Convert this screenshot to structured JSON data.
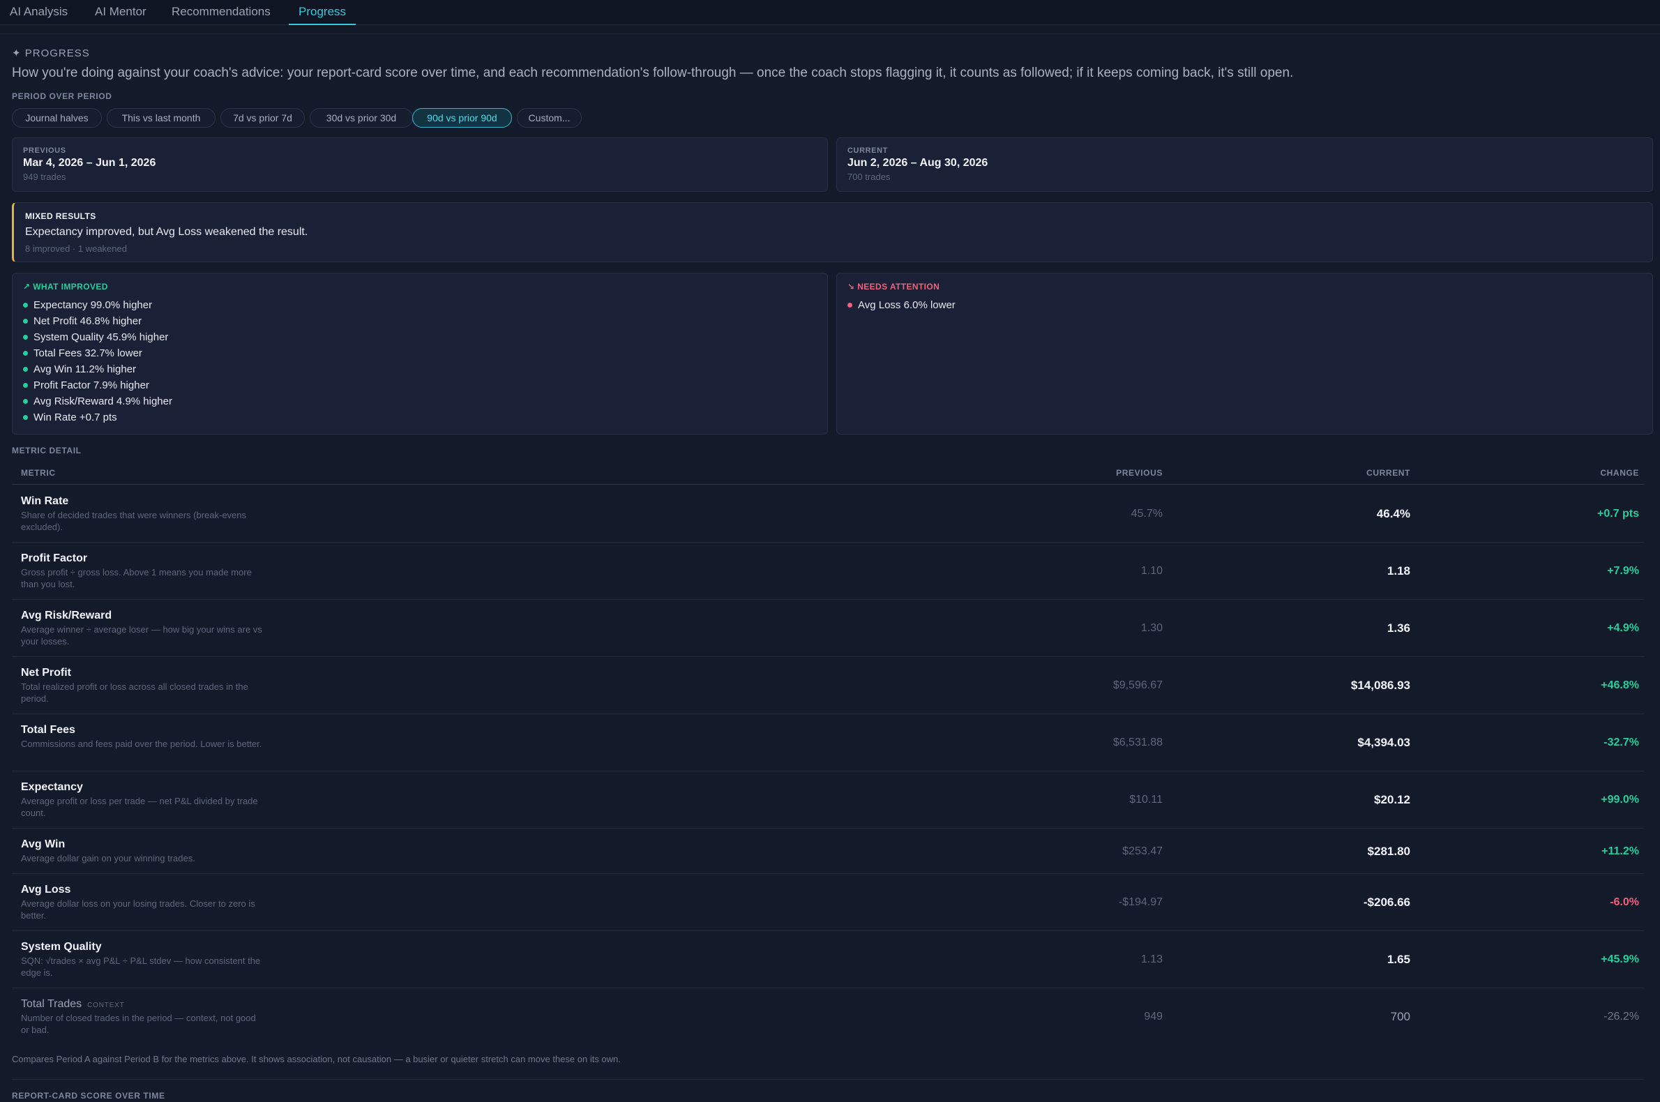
{
  "tabs": [
    "AI Analysis",
    "AI Mentor",
    "Recommendations",
    "Progress"
  ],
  "heading": "✦ PROGRESS",
  "intro": "How you're doing against your coach's advice: your report-card score over time, and each recommendation's follow-through — once the coach stops flagging it, it counts as followed; if it keeps coming back, it's still open.",
  "period_label": "PERIOD OVER PERIOD",
  "period_options": [
    "Journal halves",
    "This vs last month",
    "7d vs prior 7d",
    "30d vs prior 30d",
    "90d vs prior 90d",
    "Custom..."
  ],
  "period_selected": "90d vs prior 90d",
  "previous": {
    "label": "PREVIOUS",
    "range": "Mar 4, 2026 – Jun 1, 2026",
    "trades": "949 trades"
  },
  "current": {
    "label": "CURRENT",
    "range": "Jun 2, 2026 – Aug 30, 2026",
    "trades": "700 trades"
  },
  "verdict": {
    "title": "MIXED RESULTS",
    "message": "Expectancy improved, but Avg Loss weakened the result.",
    "counts": "8 improved · 1 weakened"
  },
  "improved": {
    "title": "↗ WHAT IMPROVED",
    "items": [
      "Expectancy 99.0% higher",
      "Net Profit 46.8% higher",
      "System Quality 45.9% higher",
      "Total Fees 32.7% lower",
      "Avg Win 11.2% higher",
      "Profit Factor 7.9% higher",
      "Avg Risk/Reward 4.9% higher",
      "Win Rate +0.7 pts"
    ]
  },
  "attention": {
    "title": "↘ NEEDS ATTENTION",
    "items": [
      "Avg Loss 6.0% lower"
    ]
  },
  "metric_detail_label": "METRIC DETAIL",
  "table_headers": {
    "metric": "METRIC",
    "previous": "PREVIOUS",
    "current": "CURRENT",
    "change": "CHANGE"
  },
  "metrics": [
    {
      "name": "Win Rate",
      "desc": "Share of decided trades that were winners (break-evens excluded).",
      "previous": "45.7%",
      "current": "46.4%",
      "change": "+0.7 pts",
      "trend": "pos"
    },
    {
      "name": "Profit Factor",
      "desc": "Gross profit ÷ gross loss. Above 1 means you made more than you lost.",
      "previous": "1.10",
      "current": "1.18",
      "change": "+7.9%",
      "trend": "pos"
    },
    {
      "name": "Avg Risk/Reward",
      "desc": "Average winner ÷ average loser — how big your wins are vs your losses.",
      "previous": "1.30",
      "current": "1.36",
      "change": "+4.9%",
      "trend": "pos"
    },
    {
      "name": "Net Profit",
      "desc": "Total realized profit or loss across all closed trades in the period.",
      "previous": "$9,596.67",
      "current": "$14,086.93",
      "change": "+46.8%",
      "trend": "pos"
    },
    {
      "name": "Total Fees",
      "desc": "Commissions and fees paid over the period. Lower is better.",
      "previous": "$6,531.88",
      "current": "$4,394.03",
      "change": "-32.7%",
      "trend": "pos"
    },
    {
      "name": "Expectancy",
      "desc": "Average profit or loss per trade — net P&L divided by trade count.",
      "previous": "$10.11",
      "current": "$20.12",
      "change": "+99.0%",
      "trend": "pos"
    },
    {
      "name": "Avg Win",
      "desc": "Average dollar gain on your winning trades.",
      "previous": "$253.47",
      "current": "$281.80",
      "change": "+11.2%",
      "trend": "pos"
    },
    {
      "name": "Avg Loss",
      "desc": "Average dollar loss on your losing trades. Closer to zero is better.",
      "previous": "-$194.97",
      "current": "-$206.66",
      "change": "-6.0%",
      "trend": "neg"
    },
    {
      "name": "System Quality",
      "desc": "SQN: √trades × avg P&L ÷ P&L stdev — how consistent the edge is.",
      "previous": "1.13",
      "current": "1.65",
      "change": "+45.9%",
      "trend": "pos"
    },
    {
      "name": "Total Trades",
      "tag": "CONTEXT",
      "desc": "Number of closed trades in the period — context, not good or bad.",
      "previous": "949",
      "current": "700",
      "change": "-26.2%",
      "trend": "neu"
    }
  ],
  "footnote": "Compares Period A against Period B for the metrics above. It shows association, not causation — a busier or quieter stretch can move these on its own.",
  "score_label": "REPORT-CARD SCORE OVER TIME",
  "colors": {
    "accent": "#38c9d9",
    "positive": "#26d09a",
    "negative": "#f0627a",
    "warning": "#e3b341",
    "background": "#121826"
  }
}
